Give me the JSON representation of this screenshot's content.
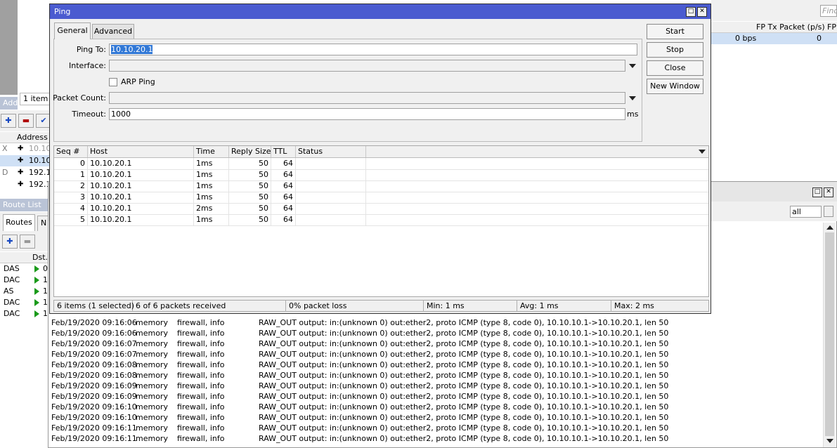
{
  "bg_left": {
    "find_placeholder": "Find",
    "item_count": "1 item",
    "address_title": "Addr",
    "address_col": "Address",
    "address_rows": [
      {
        "flag": "X",
        "text": "10.10."
      },
      {
        "flag": "",
        "text": "10.10."
      },
      {
        "flag": "D",
        "text": "192.16"
      },
      {
        "flag": "",
        "text": "192.16"
      }
    ],
    "route_title": "Route List",
    "route_tab": "Routes",
    "route_tab2": "N",
    "route_col": "Dst.",
    "route_rows": [
      {
        "flag": "DAS",
        "text": "0"
      },
      {
        "flag": "DAC",
        "text": "1"
      },
      {
        "flag": "AS",
        "text": "1"
      },
      {
        "flag": "DAC",
        "text": "1"
      },
      {
        "flag": "DAC",
        "text": "1"
      }
    ]
  },
  "bg_right": {
    "col1": "FP Tx Packet (p/s)",
    "col2": "FP",
    "val_bps": "0 bps",
    "val_0": "0",
    "log_filter": "all"
  },
  "log_rows": [
    {
      "time": "Feb/19/2020 09:16:06",
      "buffer": "memory",
      "topics": "firewall, info",
      "msg": "RAW_OUT output: in:(unknown 0) out:ether2, proto ICMP (type 8, code 0), 10.10.10.1->10.10.20.1, len 50"
    },
    {
      "time": "Feb/19/2020 09:16:06",
      "buffer": "memory",
      "topics": "firewall, info",
      "msg": "RAW_OUT output: in:(unknown 0) out:ether2, proto ICMP (type 8, code 0), 10.10.10.1->10.10.20.1, len 50"
    },
    {
      "time": "Feb/19/2020 09:16:07",
      "buffer": "memory",
      "topics": "firewall, info",
      "msg": "RAW_OUT output: in:(unknown 0) out:ether2, proto ICMP (type 8, code 0), 10.10.10.1->10.10.20.1, len 50"
    },
    {
      "time": "Feb/19/2020 09:16:07",
      "buffer": "memory",
      "topics": "firewall, info",
      "msg": "RAW_OUT output: in:(unknown 0) out:ether2, proto ICMP (type 8, code 0), 10.10.10.1->10.10.20.1, len 50"
    },
    {
      "time": "Feb/19/2020 09:16:08",
      "buffer": "memory",
      "topics": "firewall, info",
      "msg": "RAW_OUT output: in:(unknown 0) out:ether2, proto ICMP (type 8, code 0), 10.10.10.1->10.10.20.1, len 50"
    },
    {
      "time": "Feb/19/2020 09:16:08",
      "buffer": "memory",
      "topics": "firewall, info",
      "msg": "RAW_OUT output: in:(unknown 0) out:ether2, proto ICMP (type 8, code 0), 10.10.10.1->10.10.20.1, len 50"
    },
    {
      "time": "Feb/19/2020 09:16:09",
      "buffer": "memory",
      "topics": "firewall, info",
      "msg": "RAW_OUT output: in:(unknown 0) out:ether2, proto ICMP (type 8, code 0), 10.10.10.1->10.10.20.1, len 50"
    },
    {
      "time": "Feb/19/2020 09:16:09",
      "buffer": "memory",
      "topics": "firewall, info",
      "msg": "RAW_OUT output: in:(unknown 0) out:ether2, proto ICMP (type 8, code 0), 10.10.10.1->10.10.20.1, len 50"
    },
    {
      "time": "Feb/19/2020 09:16:10",
      "buffer": "memory",
      "topics": "firewall, info",
      "msg": "RAW_OUT output: in:(unknown 0) out:ether2, proto ICMP (type 8, code 0), 10.10.10.1->10.10.20.1, len 50"
    },
    {
      "time": "Feb/19/2020 09:16:10",
      "buffer": "memory",
      "topics": "firewall, info",
      "msg": "RAW_OUT output: in:(unknown 0) out:ether2, proto ICMP (type 8, code 0), 10.10.10.1->10.10.20.1, len 50"
    },
    {
      "time": "Feb/19/2020 09:16:11",
      "buffer": "memory",
      "topics": "firewall, info",
      "msg": "RAW_OUT output: in:(unknown 0) out:ether2, proto ICMP (type 8, code 0), 10.10.10.1->10.10.20.1, len 50"
    },
    {
      "time": "Feb/19/2020 09:16:11",
      "buffer": "memory",
      "topics": "firewall, info",
      "msg": "RAW_OUT output: in:(unknown 0) out:ether2, proto ICMP (type 8, code 0), 10.10.10.1->10.10.20.1, len 50"
    }
  ],
  "ping": {
    "title": "Ping",
    "tabs": {
      "general": "General",
      "advanced": "Advanced"
    },
    "buttons": {
      "start": "Start",
      "stop": "Stop",
      "close": "Close",
      "new_window": "New Window"
    },
    "labels": {
      "ping_to": "Ping To:",
      "interface": "Interface:",
      "arp_ping": "ARP Ping",
      "packet_count": "Packet Count:",
      "timeout": "Timeout:",
      "ms": "ms"
    },
    "values": {
      "ping_to": "10.10.20.1",
      "interface": "",
      "packet_count": "",
      "timeout": "1000"
    },
    "columns": {
      "seq": "Seq #",
      "host": "Host",
      "time": "Time",
      "reply_size": "Reply Size",
      "ttl": "TTL",
      "status": "Status"
    },
    "rows": [
      {
        "seq": "0",
        "host": "10.10.20.1",
        "time": "1ms",
        "size": "50",
        "ttl": "64",
        "status": ""
      },
      {
        "seq": "1",
        "host": "10.10.20.1",
        "time": "1ms",
        "size": "50",
        "ttl": "64",
        "status": ""
      },
      {
        "seq": "2",
        "host": "10.10.20.1",
        "time": "1ms",
        "size": "50",
        "ttl": "64",
        "status": ""
      },
      {
        "seq": "3",
        "host": "10.10.20.1",
        "time": "1ms",
        "size": "50",
        "ttl": "64",
        "status": ""
      },
      {
        "seq": "4",
        "host": "10.10.20.1",
        "time": "2ms",
        "size": "50",
        "ttl": "64",
        "status": ""
      },
      {
        "seq": "5",
        "host": "10.10.20.1",
        "time": "1ms",
        "size": "50",
        "ttl": "64",
        "status": ""
      }
    ],
    "status": {
      "items": "6 items (1 selected)",
      "received": "6 of 6 packets received",
      "loss": "0% packet loss",
      "min": "Min: 1 ms",
      "avg": "Avg: 1 ms",
      "max": "Max: 2 ms"
    }
  },
  "colors": {
    "titlebar": "#4a5bd0",
    "selection": "#cfe0f5",
    "input_selection": "#3178d6"
  }
}
